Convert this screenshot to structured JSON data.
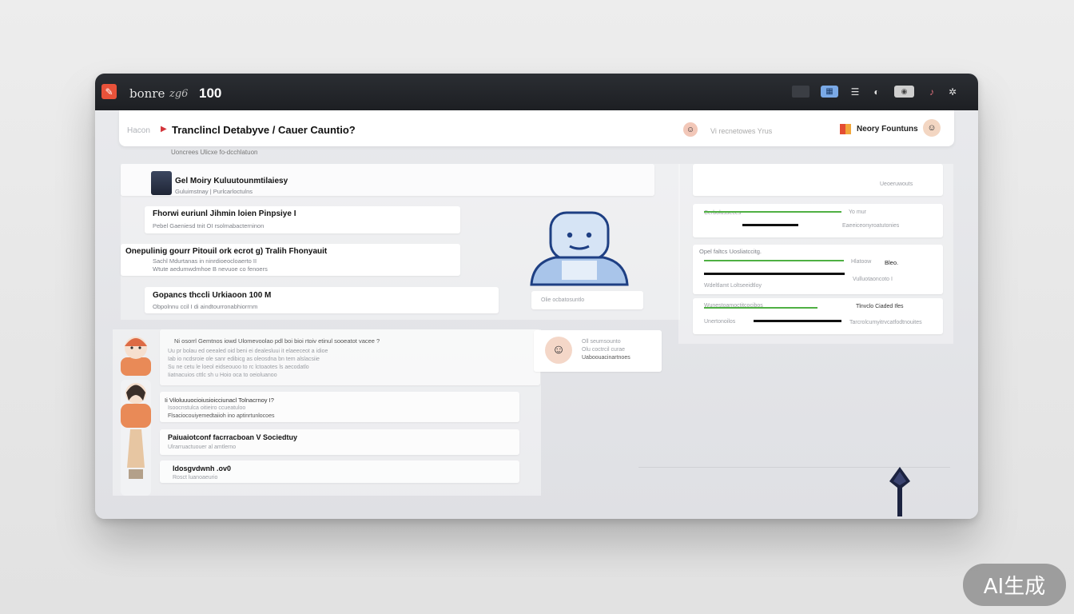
{
  "window": {
    "app_name": "bonre",
    "app_sub": "zg6",
    "app_num": "100"
  },
  "titlebar_icons": [
    "window-icon",
    "grid-icon",
    "menu-icon",
    "moon-icon",
    "toggle-icon",
    "bell-icon",
    "settings-icon"
  ],
  "toolbar": {
    "breadcrumb_root": "Hacon",
    "title": "Tranclincl Detabyve / Cauer Cauntio?",
    "status_text": "Vi recnetowes Yrus",
    "button_label": "Neory Fountuns",
    "subcrumb": "Uoncrees Ulicxe fo-dcchlatuon"
  },
  "left_panel": {
    "header_title": "Gel Moiry Kuluutounmtilaiesy",
    "header_sub": "Guluimstnay | Purlcarloctulns",
    "items": [
      {
        "title": "Fhorwi euriunl Jihmin loien Pinpsiye I",
        "sub": "Pebel Gaeniesd tnit OI rsolmabacterninon"
      },
      {
        "title": "Onepulinig gourr Pitouil ork ecrot g) Tralih Fhonyauit",
        "sub": "Sachl Mdurtanas in ninrdioeocloaerto II",
        "sub2": "Wtute aedumwdmhoe B nevuoe co fenoers"
      },
      {
        "title": "Gopancs thccli Urkiaoon 100 M",
        "sub": "Obpolnnu ccil I di aindtourronabhiorrnm"
      }
    ],
    "robot_caption": "Olie ocbatosuntlo"
  },
  "right_panel": {
    "top_label": "Ueoeruwouts",
    "cards": [
      {
        "label": "Cerbolusseces",
        "right": "Yo mur",
        "sub": "Eaeeiceonyroatutonies",
        "green": 0.82,
        "black": 0.5
      },
      {
        "label": "Opel faltcs Uosliatccitg.",
        "right": "Bleo.",
        "mid": "Hlatoow",
        "sub": "Vulluotaoncoto I",
        "sub2": "Wdeltlamt Loltseeidtloy",
        "green": 0.92,
        "black": 0.96
      },
      {
        "label": "Wunestoamoctitcocibos",
        "right": "Tlnvclo Ciaded Ifes",
        "sub": "Unertonoilos",
        "sub2": "Tarcrolcumyitrvcatfodtnouites",
        "green": 0.73,
        "black": 0.68
      }
    ]
  },
  "lower_panel": {
    "intro_title": "Ni osorrl Gemtnos iowd Ulomevoolao pdl boi bioi rtoiv etinul sooeatot vacee ?",
    "intro_lines": [
      "Uu pr bolau ed oeealed oid beni ei dealesluui it elaeeceot a idioe",
      "Iab io ncdsroie ole sanr edibicg as oleosdna bn tem alslacsiie",
      "Su ne cetu le loeol eidseouoo to rc lctoaotes ls aecodatlo",
      "Iiatnacuios cttlc sh u Hoio oca to oeioluanoo"
    ],
    "items": [
      {
        "title": "Ii Viloluuuocioiusioicciunacl Tolnacrnoy I?",
        "sub": "Isoocnstulca oitieiro ccueatuloo",
        "sub2": "Flsaciocouiyemedtaiioh ino aptinrtunlocoes"
      },
      {
        "title": "Paiuaiotconf facrracboan V Sociedtuy",
        "sub": "Ulrarruactuouer al amtlerno"
      },
      {
        "title": "Idosgvdwnh .ov0",
        "sub": "Rosct luanoaeurio"
      }
    ],
    "note_card": {
      "line1": "Oll seumsounto",
      "line2": "Olu coctrcil curae",
      "line3": "Uaboouacinartnoes"
    }
  },
  "watermark": "AI生成"
}
